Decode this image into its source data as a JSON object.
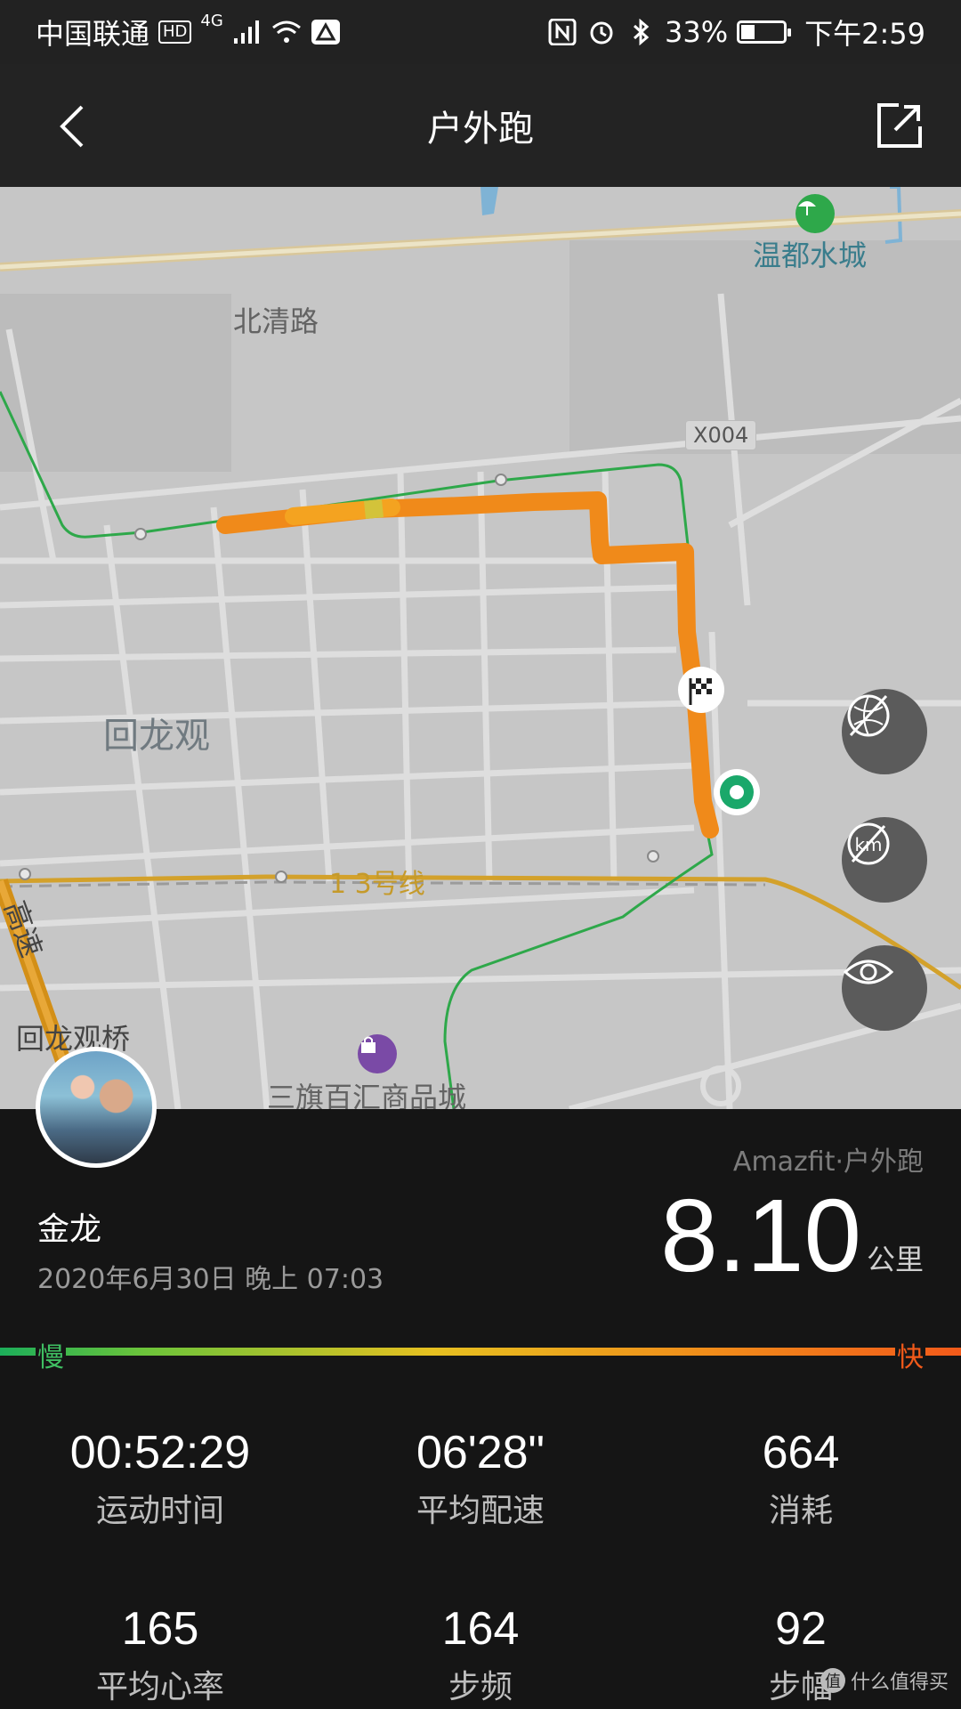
{
  "status_bar": {
    "carrier": "中国联通",
    "hd_badge": "HD",
    "network": "4G",
    "battery": "33%",
    "time": "下午2:59",
    "battery_level": 0.33
  },
  "nav": {
    "title": "户外跑"
  },
  "map": {
    "labels": {
      "beiqing_road": "北清路",
      "huilongguan": "回龙观",
      "wendu_water_city": "温都水城",
      "road_x004": "X004",
      "line_13": "1 3号线",
      "huilongguan_bridge": "回龙观桥",
      "gaosu": "高速",
      "sanqi_mall": "三旗百汇商品城"
    }
  },
  "workout": {
    "source": "Amazfit·户外跑",
    "user_name": "金龙",
    "datetime": "2020年6月30日 晚上 07:03",
    "distance": "8.10",
    "distance_unit": "公里"
  },
  "speed_legend": {
    "slow": "慢",
    "fast": "快"
  },
  "stats": [
    {
      "value": "00:52:29",
      "label": "运动时间"
    },
    {
      "value": "06'28\"",
      "label": "平均配速"
    },
    {
      "value": "664",
      "label": "消耗"
    },
    {
      "value": "165",
      "label": "平均心率"
    },
    {
      "value": "164",
      "label": "步频"
    },
    {
      "value": "92",
      "label": "步幅"
    }
  ],
  "watermark": "什么值得买",
  "colors": {
    "route_orange": "#f08a1a",
    "route_green": "#2ea84a",
    "accent_fast": "#f25a1a",
    "accent_slow": "#1cae5a"
  }
}
